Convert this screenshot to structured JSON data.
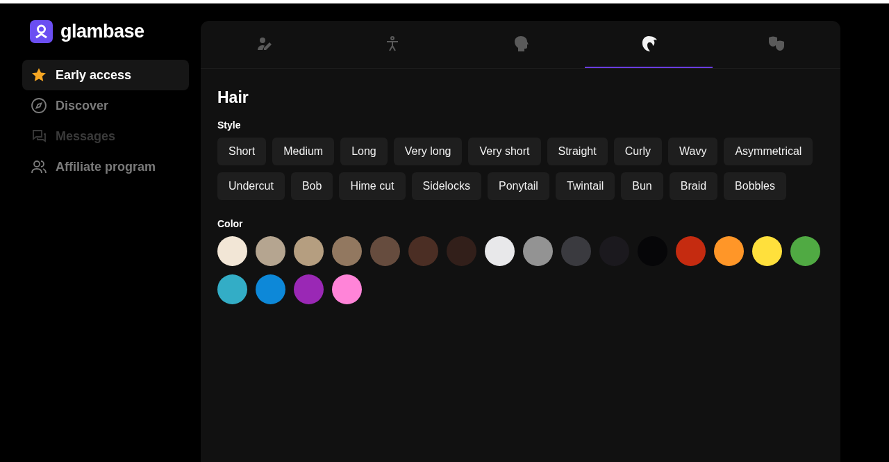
{
  "brand": {
    "name": "glambase"
  },
  "sidebar": {
    "items": [
      {
        "kind": "star",
        "label": "Early access",
        "selected": true,
        "disabled": false
      },
      {
        "kind": "compass",
        "label": "Discover",
        "selected": false,
        "disabled": false
      },
      {
        "kind": "chat",
        "label": "Messages",
        "selected": false,
        "disabled": true
      },
      {
        "kind": "users",
        "label": "Affiliate program",
        "selected": false,
        "disabled": false
      }
    ]
  },
  "tabs": [
    {
      "kind": "user-edit",
      "selected": false
    },
    {
      "kind": "body",
      "selected": false
    },
    {
      "kind": "head",
      "selected": false
    },
    {
      "kind": "hair",
      "selected": true
    },
    {
      "kind": "masks",
      "selected": false
    }
  ],
  "section": {
    "title": "Hair",
    "style": {
      "label": "Style",
      "options": [
        "Short",
        "Medium",
        "Long",
        "Very long",
        "Very short",
        "Straight",
        "Curly",
        "Wavy",
        "Asymmetrical",
        "Undercut",
        "Bob",
        "Hime cut",
        "Sidelocks",
        "Ponytail",
        "Twintail",
        "Bun",
        "Braid",
        "Bobbles"
      ]
    },
    "color": {
      "label": "Color",
      "swatches": [
        {
          "color": "#f2e6d6"
        },
        {
          "color": "#b5a590"
        },
        {
          "color": "#b59e80"
        },
        {
          "color": "#927860"
        },
        {
          "color": "#664c3e"
        },
        {
          "color": "#4b2e24"
        },
        {
          "color": "#321f1a"
        },
        {
          "color": "#e8e8ea"
        },
        {
          "color": "#939393"
        },
        {
          "color": "#3a3a3f"
        },
        {
          "color": "#1b191e"
        },
        {
          "color": "#060608"
        },
        {
          "color": "#c52b10"
        },
        {
          "color": "#ff9628"
        },
        {
          "color": "#ffe03c"
        },
        {
          "color": "#50aa43"
        },
        {
          "color": "#33adc6"
        },
        {
          "color": "#0d88d8"
        },
        {
          "color": "#9a28b5"
        },
        {
          "color": "#ff84d8"
        }
      ]
    }
  }
}
